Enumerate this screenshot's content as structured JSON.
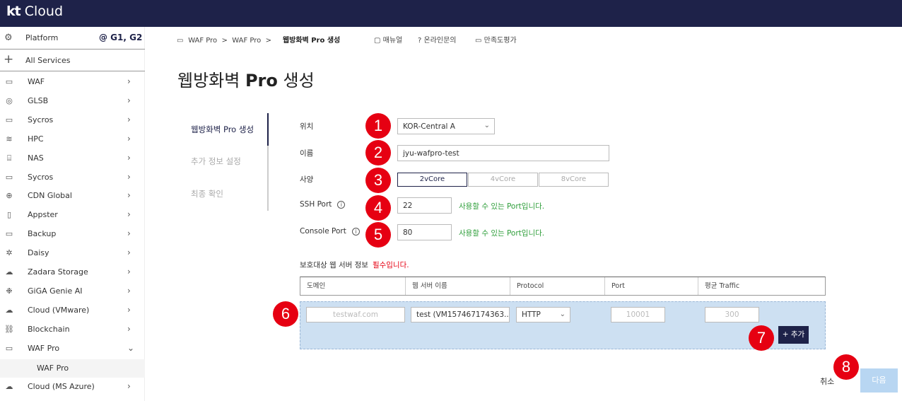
{
  "header": {
    "logo_kt": "kt",
    "logo_cloud": "Cloud"
  },
  "sidebar": {
    "platform_label": "Platform",
    "platform_value": "@ G1, G2",
    "all_services": "All Services",
    "items": [
      {
        "label": "WAF",
        "icon": "server-icon",
        "chev": "›"
      },
      {
        "label": "GLSB",
        "icon": "globe-lb-icon",
        "chev": "›"
      },
      {
        "label": "Sycros",
        "icon": "server-icon",
        "chev": "›"
      },
      {
        "label": "HPC",
        "icon": "layers-icon",
        "chev": "›"
      },
      {
        "label": "NAS",
        "icon": "database-icon",
        "chev": "›"
      },
      {
        "label": "Sycros",
        "icon": "server-icon",
        "chev": "›"
      },
      {
        "label": "CDN Global",
        "icon": "globe-icon",
        "chev": "›"
      },
      {
        "label": "Appster",
        "icon": "mobile-icon",
        "chev": "›"
      },
      {
        "label": "Backup",
        "icon": "server-icon",
        "chev": "›"
      },
      {
        "label": "Daisy",
        "icon": "atom-icon",
        "chev": "›"
      },
      {
        "label": "Zadara Storage",
        "icon": "cloud-storage-icon",
        "chev": "›"
      },
      {
        "label": "GiGA Genie AI",
        "icon": "ai-icon",
        "chev": "›"
      },
      {
        "label": "Cloud (VMware)",
        "icon": "cloud-icon",
        "chev": "›"
      },
      {
        "label": "Blockchain",
        "icon": "blockchain-icon",
        "chev": "›"
      },
      {
        "label": "WAF Pro",
        "icon": "server-icon",
        "chev": "⌄"
      }
    ],
    "sub_item": "WAF Pro",
    "last_item": {
      "label": "Cloud (MS Azure)",
      "icon": "cloud-icon",
      "chev": "›"
    }
  },
  "breadcrumb": {
    "p1": "WAF Pro",
    "sep": ">",
    "p2": "WAF Pro",
    "current": "웹방화벽 Pro 생성"
  },
  "topmenu": {
    "manual": "매뉴얼",
    "inquiry": "온라인문의",
    "survey": "만족도평가"
  },
  "page_title_prefix": "웹방화벽 ",
  "page_title_bold": "Pro",
  "page_title_suffix": " 생성",
  "steps": [
    "웹방화벽 Pro 생성",
    "추가 정보 설정",
    "최종 확인"
  ],
  "form": {
    "location_label": "위치",
    "location_value": "KOR-Central A",
    "name_label": "이름",
    "name_value": "jyu-wafpro-test",
    "spec_label": "사양",
    "spec_options": [
      "2vCore",
      "4vCore",
      "8vCore"
    ],
    "ssh_label": "SSH Port",
    "ssh_value": "22",
    "ssh_status": "사용할 수 있는 Port입니다.",
    "console_label": "Console Port",
    "console_value": "80",
    "console_status": "사용할 수 있는 Port입니다."
  },
  "badges": [
    "1",
    "2",
    "3",
    "4",
    "5",
    "6",
    "7",
    "8"
  ],
  "table": {
    "title": "보호대상 웹 서버 정보",
    "required": "필수입니다.",
    "headers": [
      "도메인",
      "웹 서버 이름",
      "Protocol",
      "Port",
      "평균 Traffic"
    ],
    "row": {
      "domain_placeholder": "testwaf.com",
      "server_value": "test (VM157467174363...",
      "protocol_value": "HTTP",
      "port_placeholder": "10001",
      "traffic_placeholder": "300"
    },
    "add_button": "+ 추가"
  },
  "footer": {
    "cancel": "취소",
    "next": "다음"
  },
  "colors": {
    "navy": "#1e2249",
    "badge_red": "#e60012",
    "ok_green": "#2e9e3a",
    "row_blue": "#cde0f2",
    "next_disabled": "#b8d6f2"
  }
}
